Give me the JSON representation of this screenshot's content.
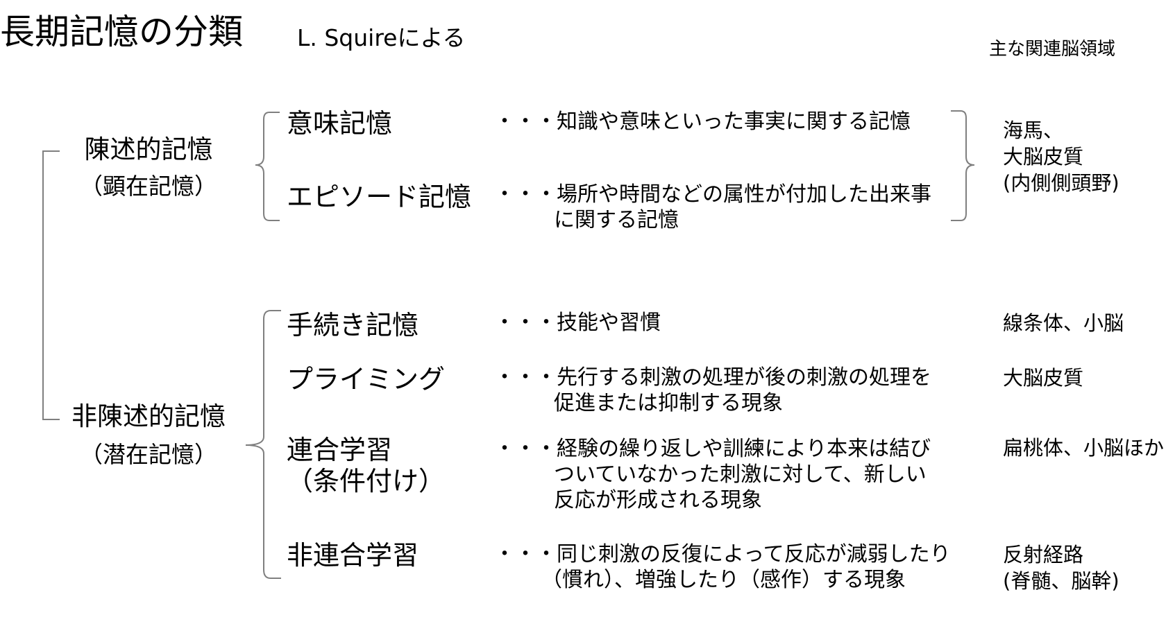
{
  "title": "長期記憶の分類",
  "subtitle": "L. Squireによる",
  "region_header": "主な関連脳領域",
  "declarative": {
    "label": "陳述的記憶",
    "sub": "（顕在記憶）",
    "items": [
      {
        "name": "意味記憶",
        "desc": [
          "・・・知識や意味といった事実に関する記憶"
        ]
      },
      {
        "name": "エピソード記憶",
        "desc": [
          "・・・場所や時間などの属性が付加した出来事",
          "に関する記憶"
        ]
      }
    ],
    "region": [
      "海馬、",
      "大脳皮質",
      "(内側側頭野)"
    ]
  },
  "nondeclarative": {
    "label": "非陳述的記憶",
    "sub": "（潜在記憶）",
    "items": [
      {
        "name": [
          "手続き記憶"
        ],
        "desc": [
          "・・・技能や習慣"
        ],
        "region": [
          "線条体、小脳"
        ]
      },
      {
        "name": [
          "プライミング"
        ],
        "desc": [
          "・・・先行する刺激の処理が後の刺激の処理を",
          "促進または抑制する現象"
        ],
        "region": [
          "大脳皮質"
        ]
      },
      {
        "name": [
          "連合学習",
          "（条件付け）"
        ],
        "desc": [
          "・・・経験の繰り返しや訓練により本来は結び",
          "ついていなかった刺激に対して、新しい",
          "反応が形成される現象"
        ],
        "region": [
          "扁桃体、小脳ほか"
        ]
      },
      {
        "name": [
          "非連合学習"
        ],
        "desc": [
          "・・・同じ刺激の反復によって反応が減弱したり",
          "（慣れ）、増強したり（感作）する現象"
        ],
        "region": [
          "反射経路",
          "(脊髄、脳幹)"
        ]
      }
    ]
  }
}
